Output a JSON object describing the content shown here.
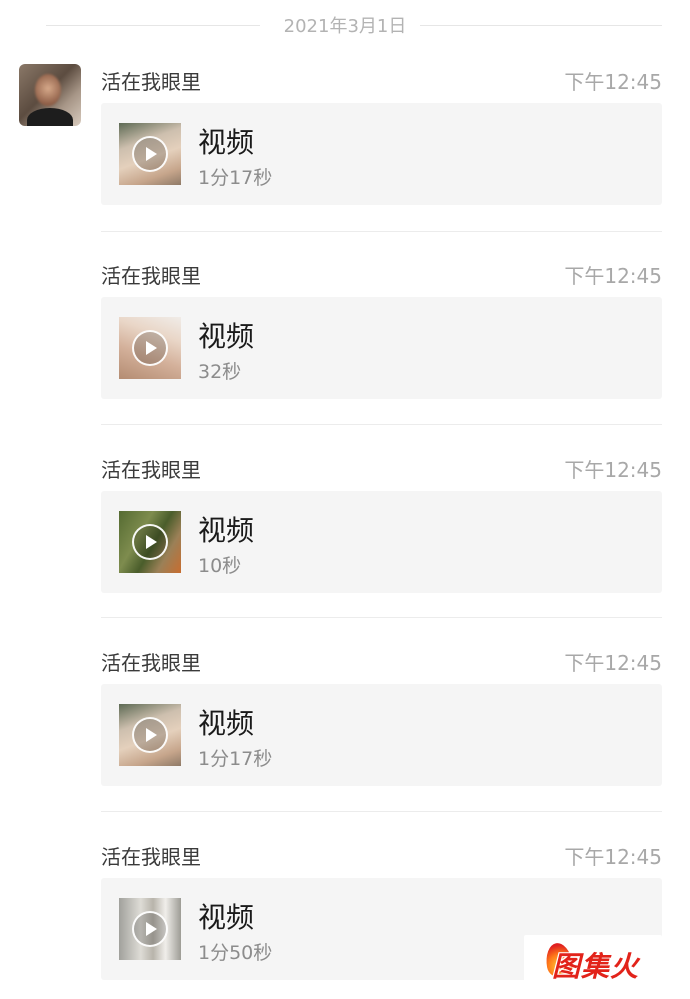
{
  "date_divider": "2021年3月1日",
  "messages": [
    {
      "sender": "活在我眼里",
      "time": "下午12:45",
      "title": "视频",
      "duration": "1分17秒"
    },
    {
      "sender": "活在我眼里",
      "time": "下午12:45",
      "title": "视频",
      "duration": "32秒"
    },
    {
      "sender": "活在我眼里",
      "time": "下午12:45",
      "title": "视频",
      "duration": "10秒"
    },
    {
      "sender": "活在我眼里",
      "time": "下午12:45",
      "title": "视频",
      "duration": "1分17秒"
    },
    {
      "sender": "活在我眼里",
      "time": "下午12:45",
      "title": "视频",
      "duration": "1分50秒"
    }
  ],
  "watermark": "图集火",
  "colors": {
    "card_background": "#f5f5f5",
    "time_text": "#a8a8a8",
    "watermark_red": "#e2231a"
  },
  "icons": {
    "play": "play-icon",
    "watermark_logo": "flame-icon"
  }
}
